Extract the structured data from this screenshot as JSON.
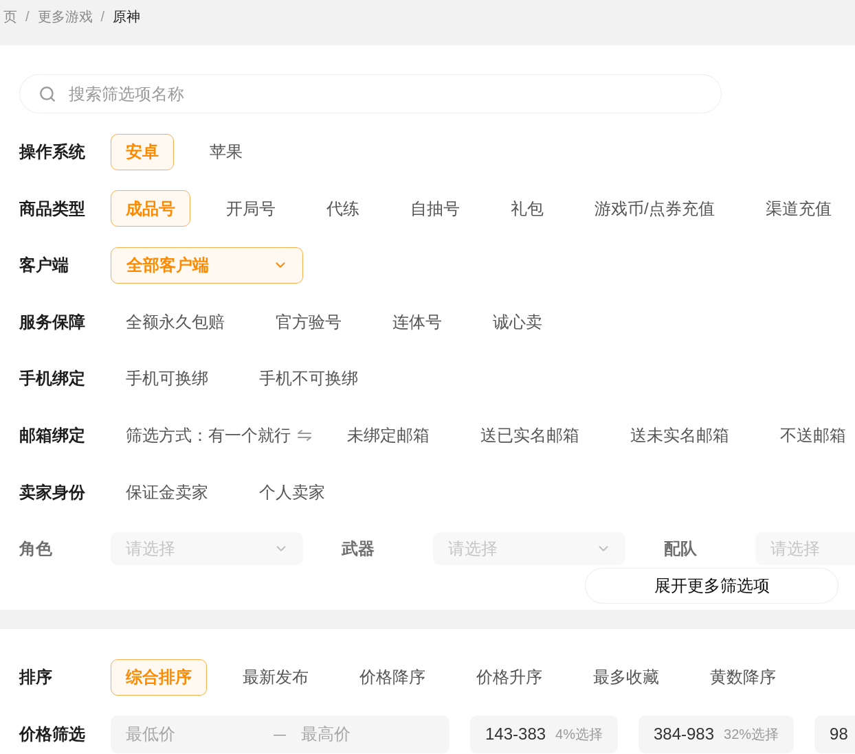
{
  "breadcrumb": {
    "items": [
      {
        "label": "页",
        "current": false
      },
      {
        "label": "更多游戏",
        "current": false
      },
      {
        "label": "原神",
        "current": true
      }
    ],
    "separators": [
      "/",
      "/"
    ]
  },
  "search": {
    "placeholder": "搜索筛选项名称"
  },
  "filters": [
    {
      "kind": "options",
      "label": "操作系统",
      "options": [
        {
          "label": "安卓",
          "selected": true
        },
        {
          "label": "苹果",
          "selected": false
        }
      ]
    },
    {
      "kind": "options",
      "label": "商品类型",
      "options": [
        {
          "label": "成品号",
          "selected": true
        },
        {
          "label": "开局号",
          "selected": false
        },
        {
          "label": "代练",
          "selected": false
        },
        {
          "label": "自抽号",
          "selected": false
        },
        {
          "label": "礼包",
          "selected": false
        },
        {
          "label": "游戏币/点券充值",
          "selected": false
        },
        {
          "label": "渠道充值",
          "selected": false
        }
      ]
    },
    {
      "kind": "dropdown",
      "label": "客户端",
      "value": "全部客户端"
    },
    {
      "kind": "options",
      "label": "服务保障",
      "options": [
        {
          "label": "全额永久包赔",
          "selected": false
        },
        {
          "label": "官方验号",
          "selected": false
        },
        {
          "label": "连体号",
          "selected": false
        },
        {
          "label": "诚心卖",
          "selected": false
        }
      ]
    },
    {
      "kind": "options",
      "label": "手机绑定",
      "options": [
        {
          "label": "手机可换绑",
          "selected": false
        },
        {
          "label": "手机不可换绑",
          "selected": false
        }
      ]
    },
    {
      "kind": "options",
      "label": "邮箱绑定",
      "mode": "筛选方式：有一个就行",
      "options": [
        {
          "label": "未绑定邮箱",
          "selected": false
        },
        {
          "label": "送已实名邮箱",
          "selected": false
        },
        {
          "label": "送未实名邮箱",
          "selected": false
        },
        {
          "label": "不送邮箱",
          "selected": false
        }
      ]
    },
    {
      "kind": "options",
      "label": "卖家身份",
      "options": [
        {
          "label": "保证金卖家",
          "selected": false
        },
        {
          "label": "个人卖家",
          "selected": false
        }
      ]
    }
  ],
  "more_filters": {
    "selects": [
      {
        "label": "角色",
        "placeholder": "请选择"
      },
      {
        "label": "武器",
        "placeholder": "请选择"
      },
      {
        "label": "配队",
        "placeholder": "请选择"
      }
    ],
    "expand_button": "展开更多筛选项"
  },
  "sort": {
    "label": "排序",
    "options": [
      {
        "label": "综合排序",
        "selected": true
      },
      {
        "label": "最新发布",
        "selected": false
      },
      {
        "label": "价格降序",
        "selected": false
      },
      {
        "label": "价格升序",
        "selected": false
      },
      {
        "label": "最多收藏",
        "selected": false
      },
      {
        "label": "黄数降序",
        "selected": false
      }
    ]
  },
  "price_filter": {
    "label": "价格筛选",
    "min_placeholder": "最低价",
    "dash": "—",
    "max_placeholder": "最高价",
    "presets": [
      {
        "range": "143-383",
        "share": "4%选择",
        "selected": false
      },
      {
        "range": "384-983",
        "share": "32%选择",
        "selected": false
      },
      {
        "range": "98",
        "selected": false
      }
    ]
  }
}
